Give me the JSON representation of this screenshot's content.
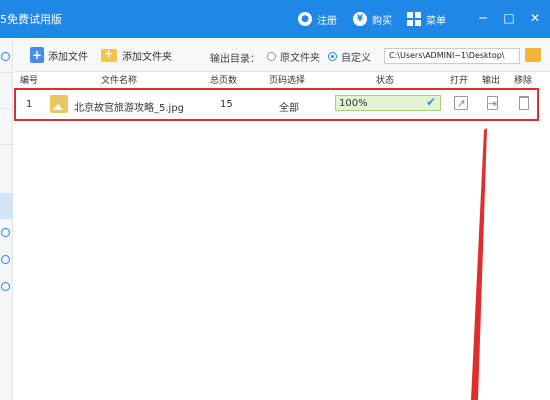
{
  "window": {
    "title": "5免费试用版",
    "actions": [
      {
        "label": "注册",
        "icon": "user-icon"
      },
      {
        "label": "购买",
        "icon": "yen-icon"
      },
      {
        "label": "菜单",
        "icon": "menu-grid-icon"
      }
    ],
    "controls": {
      "minimize": "─",
      "maximize": "□",
      "close": "✕"
    }
  },
  "toolbar": {
    "add_file": "添加文件",
    "add_folder": "添加文件夹",
    "output_label": "输出目录：",
    "radio_original": "原文件夹",
    "radio_custom": "自定义",
    "output_path": "C:\\Users\\ADMINI~1\\Desktop\\"
  },
  "table": {
    "headers": {
      "index": "编号",
      "filename": "文件名称",
      "pages": "总页数",
      "page_select": "页码选择",
      "status": "状态",
      "open": "打开",
      "output": "输出",
      "remove": "移除"
    },
    "rows": [
      {
        "index": "1",
        "filename": "北京故宫旅游攻略_5.jpg",
        "pages": "15",
        "page_select": "全部",
        "status": "100%",
        "progress": 1.0
      }
    ]
  },
  "colors": {
    "title_bar": "#1f87e5",
    "highlight_border": "#e02d2d",
    "progress_fill": "#e2f3cf"
  }
}
